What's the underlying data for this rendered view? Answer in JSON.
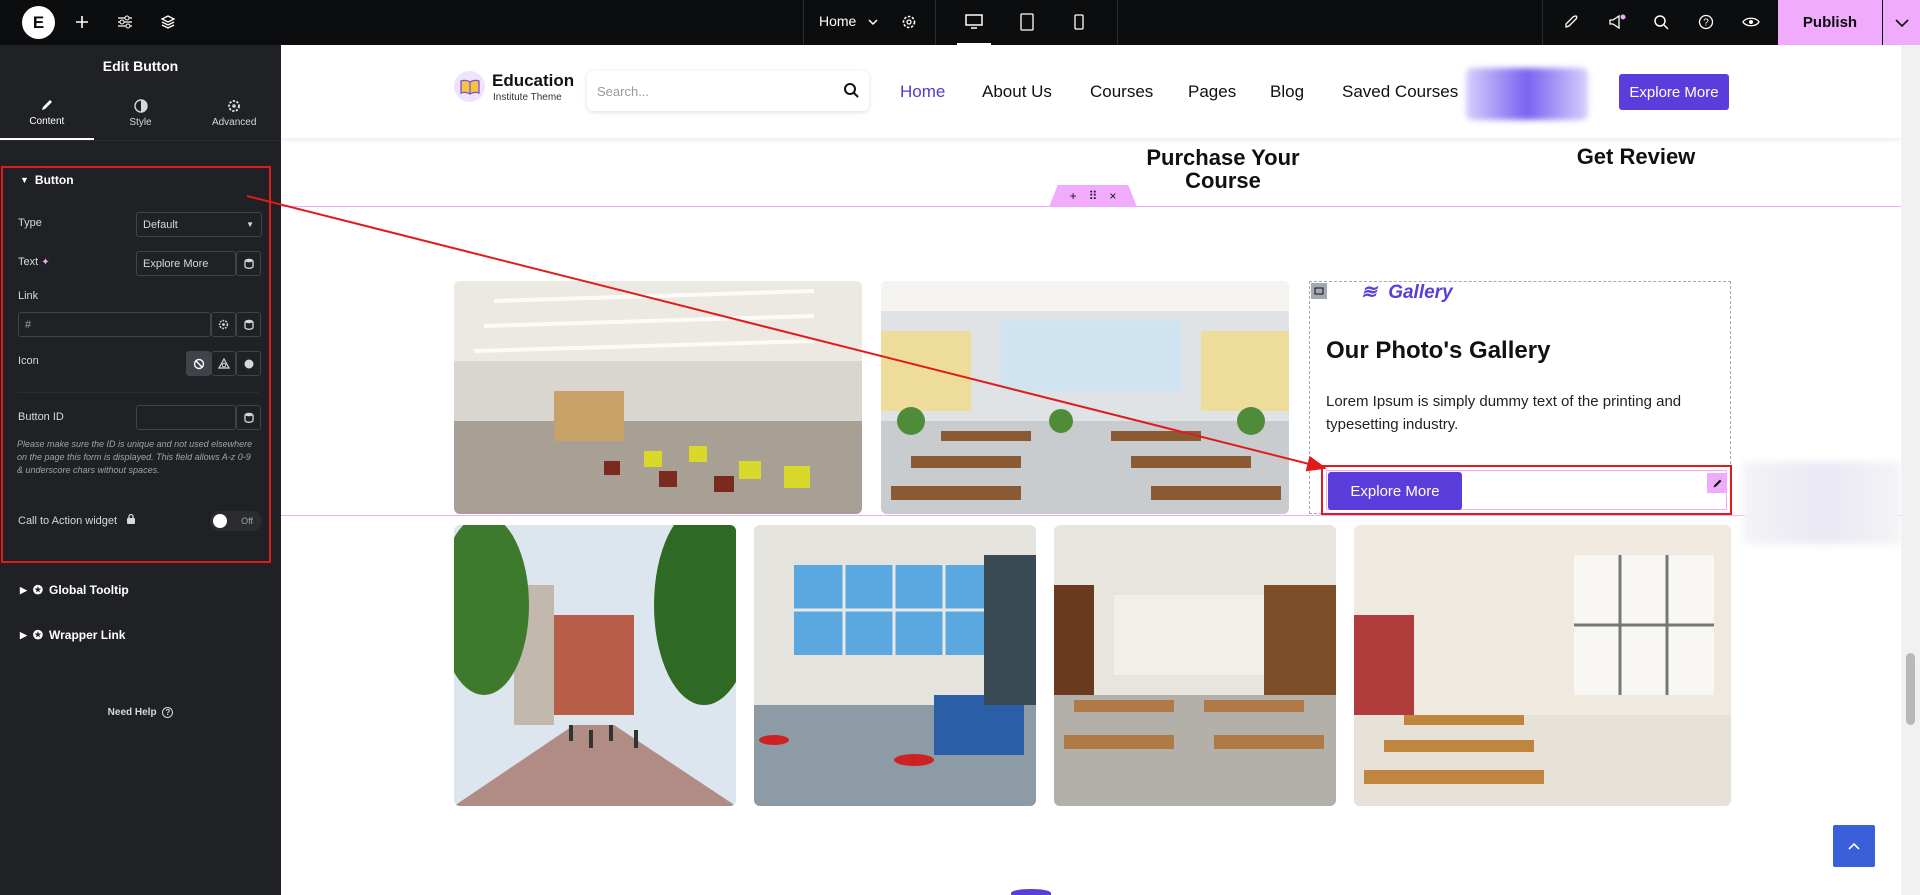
{
  "topbar": {
    "logo": "E",
    "page_name": "Home",
    "publish_label": "Publish",
    "icons": [
      "add-icon",
      "settings-sliders-icon",
      "layers-icon",
      "chevron-down-icon",
      "gear-icon",
      "desktop-icon",
      "tablet-icon",
      "mobile-icon",
      "rocket-icon",
      "megaphone-icon",
      "search-icon",
      "help-icon",
      "eye-icon",
      "chevron-down-icon"
    ]
  },
  "panel": {
    "title": "Edit Button",
    "tabs": [
      {
        "label": "Content",
        "icon": "pencil-icon"
      },
      {
        "label": "Style",
        "icon": "contrast-icon"
      },
      {
        "label": "Advanced",
        "icon": "gear-icon"
      }
    ],
    "section_title": "Button",
    "type_label": "Type",
    "type_value": "Default",
    "text_label": "Text",
    "text_value": "Explore More",
    "link_label": "Link",
    "link_value": "#",
    "icon_label": "Icon",
    "button_id_label": "Button ID",
    "button_id_value": "",
    "id_note": "Please make sure the ID is unique and not used elsewhere on the page this form is displayed. This field allows A-z  0-9 & underscore chars without spaces.",
    "cta_label": "Call to Action widget",
    "toggle_value": "Off",
    "global_tooltip": "Global Tooltip",
    "wrapper_link": "Wrapper Link",
    "need_help": "Need Help"
  },
  "site": {
    "brand_name": "Education",
    "brand_sub": "Institute Theme",
    "search_placeholder": "Search...",
    "nav": [
      "Home",
      "About Us",
      "Courses",
      "Pages",
      "Blog",
      "Saved Courses"
    ],
    "header_cta": "Explore More",
    "step_1_line1": "Purchase Your",
    "step_1_line2": "Course",
    "step_2": "Get Review",
    "gallery_tag": "Gallery",
    "gallery_title": "Our Photo's Gallery",
    "gallery_text": "Lorem Ipsum is simply dummy text of the printing and typesetting industry.",
    "gallery_cta": "Explore More"
  },
  "colors": {
    "accent": "#5b3ddc",
    "editor_pink": "#f0abfc",
    "annotation_red": "#e01b1b",
    "panel_bg": "#1f2124"
  }
}
